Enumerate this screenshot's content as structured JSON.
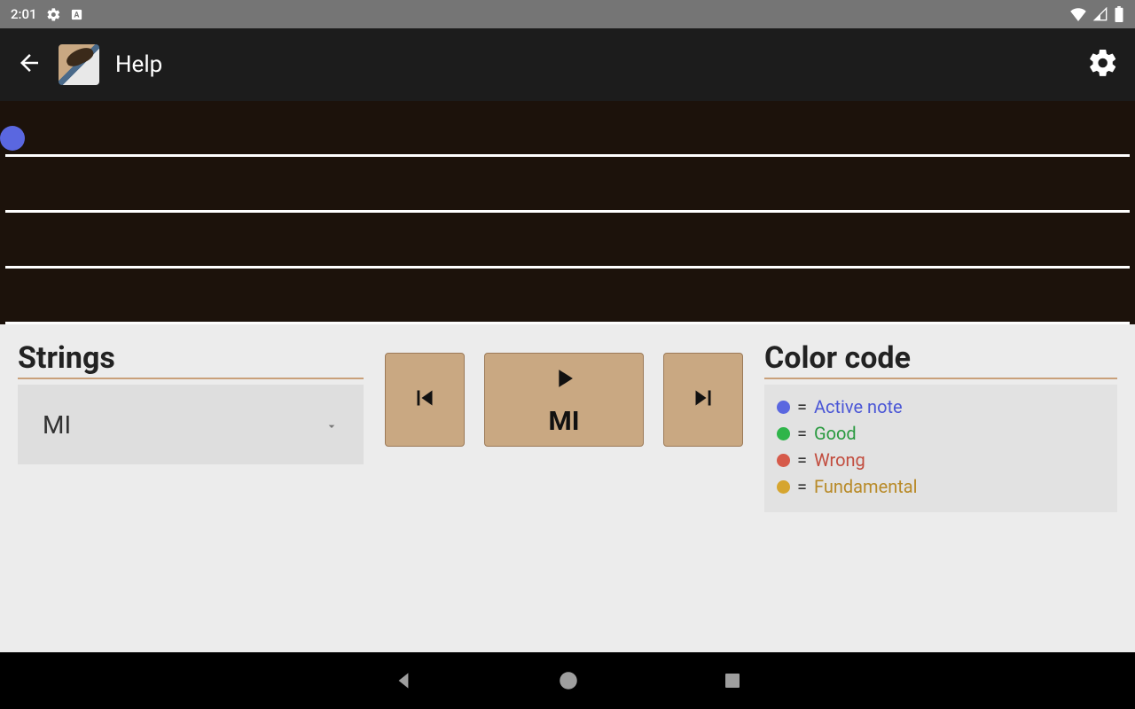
{
  "statusbar": {
    "time": "2:01"
  },
  "appbar": {
    "title": "Help"
  },
  "strings": {
    "heading": "Strings",
    "selected": "MI"
  },
  "controls": {
    "play_note": "MI"
  },
  "legend": {
    "heading": "Color code",
    "items": [
      {
        "color": "#5a67e0",
        "text_color": "#4a56d6",
        "label": "Active note"
      },
      {
        "color": "#2fb54a",
        "text_color": "#2a9a40",
        "label": "Good"
      },
      {
        "color": "#d65a4a",
        "text_color": "#c24d3f",
        "label": "Wrong"
      },
      {
        "color": "#d6a52f",
        "text_color": "#b88a28",
        "label": "Fundamental"
      }
    ]
  }
}
